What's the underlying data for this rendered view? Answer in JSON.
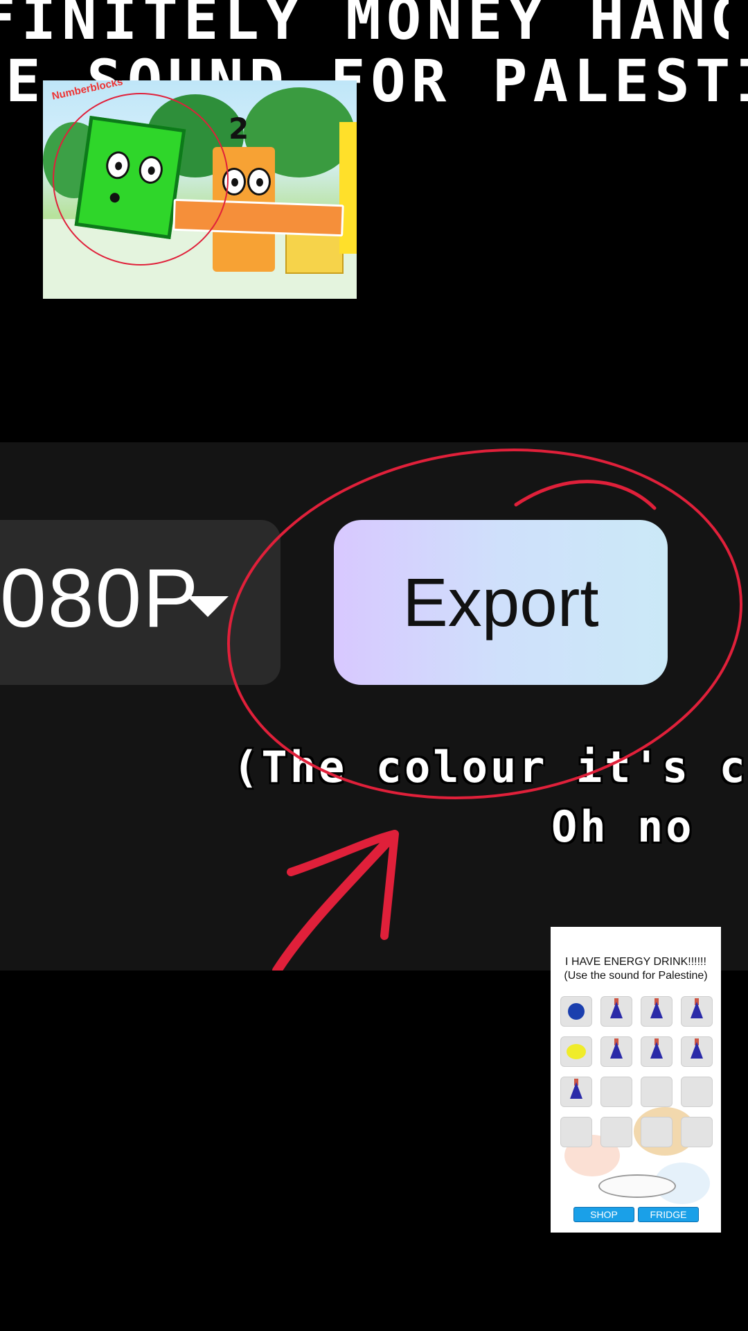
{
  "captions": {
    "line1": "FINITELY MONEY HANGRY",
    "line2": "E SOUND FOR PALESTIN"
  },
  "thumbnail": {
    "logo_text": "Numberblocks",
    "number": "2"
  },
  "editor_ui": {
    "resolution_label": "080P",
    "export_button": "Export"
  },
  "subtitles": {
    "line1": "(The colour it's cap",
    "line2": "Oh no"
  },
  "game": {
    "title_line1": "I HAVE ENERGY DRINK!!!!!!",
    "title_line2": "(Use the sound for Palestine)",
    "shop_button": "SHOP",
    "fridge_button": "FRIDGE"
  },
  "colors": {
    "annotation_red": "#e0203a",
    "export_gradient_start": "#d8c8ff",
    "export_gradient_end": "#cbe9f7",
    "panel_bg": "#141414",
    "game_button": "#1aa0e8"
  }
}
